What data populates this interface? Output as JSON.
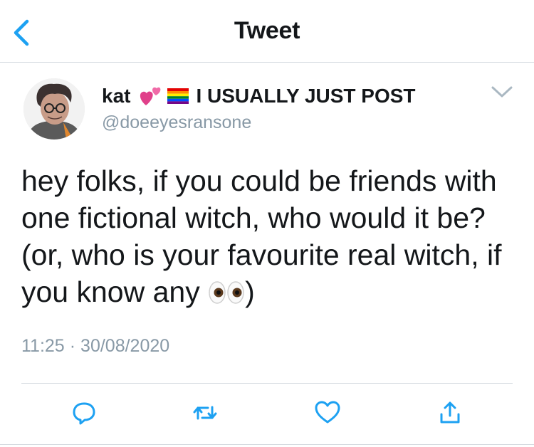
{
  "header": {
    "title": "Tweet",
    "back_icon": "chevron-left-icon",
    "accent": "#1da1f2"
  },
  "tweet": {
    "display_name": "kat",
    "display_name_suffix": "I USUALLY JUST POST",
    "name_emoji": [
      "two-hearts-icon",
      "rainbow-flag-icon"
    ],
    "handle": "@doeeyesransone",
    "text": "hey folks, if you could be friends with one fictional witch, who would it be? (or, who is your favourite real witch, if you know any",
    "text_emoji": "eyes-icon",
    "text_end": ")",
    "time": "11:25",
    "separator": "·",
    "date": "30/08/2020"
  },
  "actions": [
    "reply-icon",
    "retweet-icon",
    "like-icon",
    "share-icon"
  ],
  "colors": {
    "secondary_text": "#8899a6",
    "icon": "#1da1f2",
    "border": "#d5dbe0"
  }
}
